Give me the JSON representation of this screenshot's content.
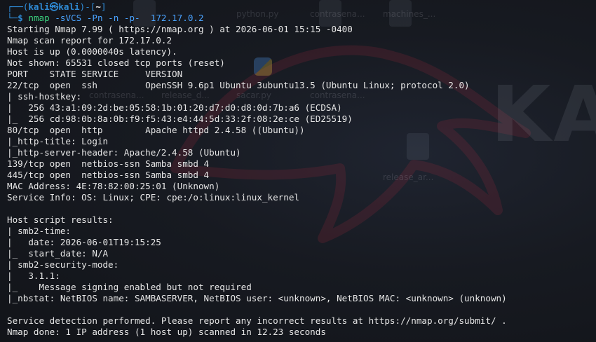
{
  "prompt": {
    "box_open": "┌──(",
    "user": "kali",
    "at_symbol": "㉿",
    "host": "kali",
    "mid": ")-[",
    "path": "~",
    "box_close": "]",
    "second_line_prefix": "└─",
    "dollar": "$",
    "command_name": "nmap",
    "command_args": " -sVCS -Pn -n -p-  172.17.0.2"
  },
  "output_lines": [
    "Starting Nmap 7.99 ( https://nmap.org ) at 2026-06-01 15:15 -0400",
    "Nmap scan report for 172.17.0.2",
    "Host is up (0.0000040s latency).",
    "Not shown: 65531 closed tcp ports (reset)",
    "PORT    STATE SERVICE     VERSION",
    "22/tcp  open  ssh         OpenSSH 9.6p1 Ubuntu 3ubuntu13.5 (Ubuntu Linux; protocol 2.0)",
    "| ssh-hostkey:",
    "|   256 43:a1:09:2d:be:05:58:1b:01:20:d7:d0:d8:0d:7b:a6 (ECDSA)",
    "|_  256 cd:98:0b:8a:0b:f9:f5:43:e4:44:5d:33:2f:08:2e:ce (ED25519)",
    "80/tcp  open  http        Apache httpd 2.4.58 ((Ubuntu))",
    "|_http-title: Login",
    "|_http-server-header: Apache/2.4.58 (Ubuntu)",
    "139/tcp open  netbios-ssn Samba smbd 4",
    "445/tcp open  netbios-ssn Samba smbd 4",
    "MAC Address: 4E:78:82:00:25:01 (Unknown)",
    "Service Info: OS: Linux; CPE: cpe:/o:linux:linux_kernel",
    "",
    "Host script results:",
    "| smb2-time:",
    "|   date: 2026-06-01T19:15:25",
    "|_  start_date: N/A",
    "| smb2-security-mode:",
    "|   3.1.1:",
    "|_    Message signing enabled but not required",
    "|_nbstat: NetBIOS name: SAMBASERVER, NetBIOS user: <unknown>, NetBIOS MAC: <unknown> (unknown)",
    "",
    "Service detection performed. Please report any incorrect results at https://nmap.org/submit/ .",
    "Nmap done: 1 IP address (1 host up) scanned in 12.23 seconds"
  ],
  "background_desktop": {
    "file_labels": [
      "python.py",
      "contrasena...",
      "machines_...",
      "contrasena...",
      "release_d...",
      "sacar.py",
      "contrasena...",
      "release_ar..."
    ],
    "wallpaper_word": "KALI"
  },
  "colors": {
    "prompt_blue": "#2f8bd6",
    "command_green": "#3ad17d",
    "args_blue": "#4aa3ff",
    "text": "#e6e6e6",
    "background": "#171a21"
  }
}
